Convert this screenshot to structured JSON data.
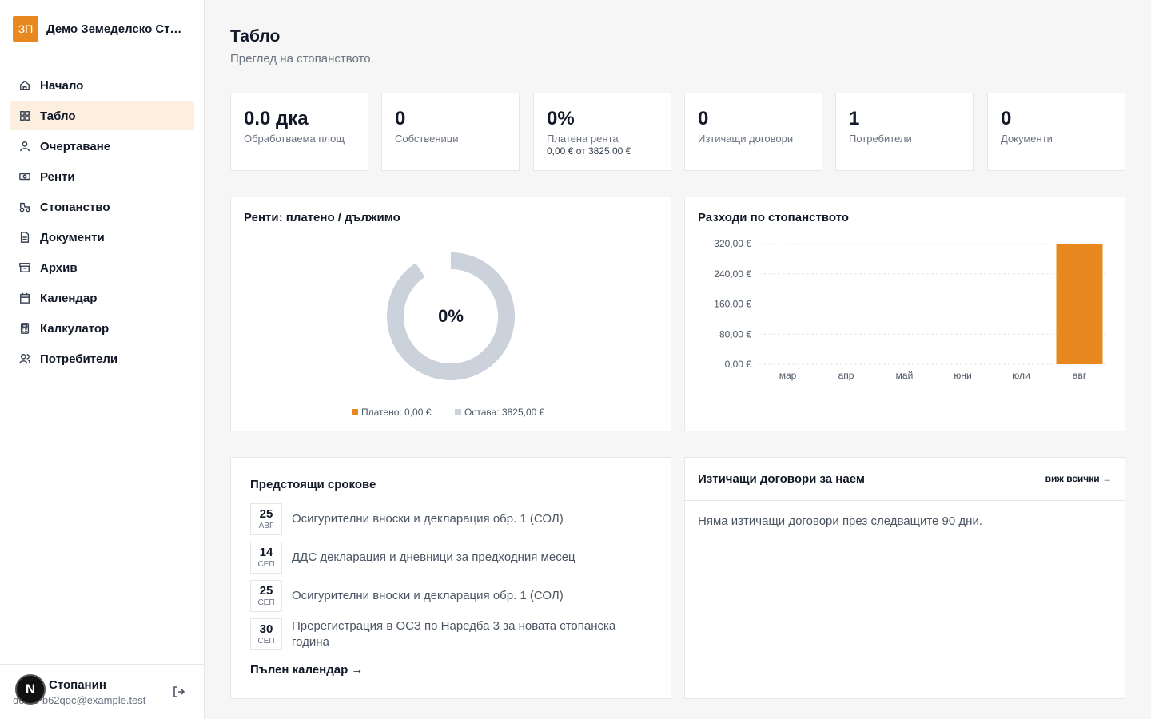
{
  "brand": {
    "logo_text": "ЗП",
    "name": "Демо Земеделско Стопанство"
  },
  "nav": [
    {
      "label": "Начало",
      "icon": "home-icon"
    },
    {
      "label": "Табло",
      "icon": "grid-icon",
      "active": true
    },
    {
      "label": "Очертаване",
      "icon": "user-icon"
    },
    {
      "label": "Ренти",
      "icon": "money-icon"
    },
    {
      "label": "Стопанство",
      "icon": "tractor-icon"
    },
    {
      "label": "Документи",
      "icon": "document-icon"
    },
    {
      "label": "Архив",
      "icon": "archive-icon"
    },
    {
      "label": "Календар",
      "icon": "calendar-icon"
    },
    {
      "label": "Калкулатор",
      "icon": "calculator-icon"
    },
    {
      "label": "Потребители",
      "icon": "users-icon"
    }
  ],
  "user": {
    "name": "Стопанин",
    "email": "demo-b62qqc@example.test",
    "avatar_letter": "N"
  },
  "page": {
    "title": "Табло",
    "subtitle": "Преглед на стопанството."
  },
  "stats": [
    {
      "value": "0.0 дка",
      "label": "Обработваема площ"
    },
    {
      "value": "0",
      "label": "Собственици"
    },
    {
      "value": "0%",
      "label": "Платена рента",
      "sub": "0,00 € от 3825,00 €"
    },
    {
      "value": "0",
      "label": "Изтичащи договори"
    },
    {
      "value": "1",
      "label": "Потребители"
    },
    {
      "value": "0",
      "label": "Документи"
    }
  ],
  "rent_card": {
    "title": "Ренти: платено / дължимо",
    "center": "0%",
    "paid_label": "Платено: 0,00 €",
    "remaining_label": "Остава: 3825,00 €",
    "colors": {
      "paid": "#e8891f",
      "remaining": "#cbd2dc"
    }
  },
  "expenses_card": {
    "title": "Разходи по стопанството"
  },
  "chart_data": {
    "type": "bar",
    "title": "Разходи по стопанството",
    "categories": [
      "мар",
      "апр",
      "май",
      "юни",
      "юли",
      "авг"
    ],
    "values": [
      0,
      0,
      0,
      0,
      0,
      320
    ],
    "ylim": [
      0,
      320
    ],
    "yticks": [
      0,
      80,
      160,
      240,
      320
    ],
    "ytick_labels": [
      "0,00 €",
      "80,00 €",
      "160,00 €",
      "240,00 €",
      "320,00 €"
    ],
    "grid": true,
    "color": "#e8891f"
  },
  "deadlines": {
    "title": "Предстоящи срокове",
    "items": [
      {
        "day": "25",
        "month": "АВГ",
        "text": "Осигурителни вноски и декларация обр. 1 (СОЛ)"
      },
      {
        "day": "14",
        "month": "СЕП",
        "text": "ДДС декларация и дневници за предходния месец"
      },
      {
        "day": "25",
        "month": "СЕП",
        "text": "Осигурителни вноски и декларация обр. 1 (СОЛ)"
      },
      {
        "day": "30",
        "month": "СЕП",
        "text": "Пререгистрация в ОСЗ по Наредба 3 за новата стопанска година"
      }
    ],
    "link": "Пълен календар →"
  },
  "contracts": {
    "title": "Изтичащи договори за наем",
    "link": "виж всички →",
    "empty": "Няма изтичащи договори през следващите 90 дни."
  }
}
